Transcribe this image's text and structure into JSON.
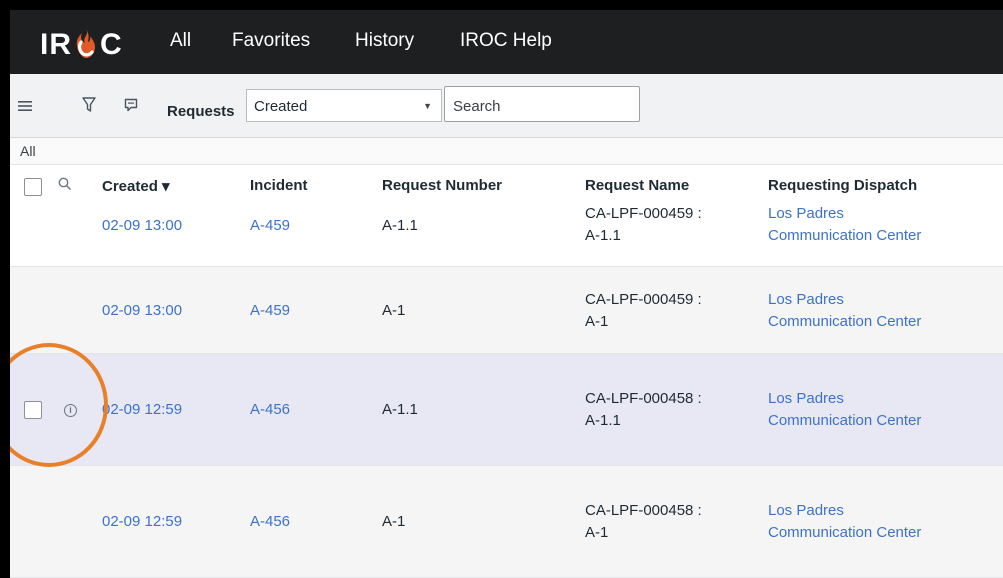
{
  "nav": {
    "logo_text_left": "IR",
    "logo_text_right": "C",
    "links": [
      "All",
      "Favorites",
      "History",
      "IROC Help"
    ]
  },
  "toolbar": {
    "menu_icon": "hamburger-icon",
    "filter_icon": "funnel-icon",
    "chat_icon": "speech-bubble-icon",
    "label": "Requests",
    "select_value": "Created",
    "search_placeholder": "Search"
  },
  "breadcrumb": "All",
  "table": {
    "headers": [
      "Created ▾",
      "Incident",
      "Request Number",
      "Request Name",
      "Requesting Dispatch"
    ],
    "rows": [
      {
        "created": "02-09 13:00",
        "incident": "A-459",
        "request_number": "A-1.1",
        "name1": "CA-LPF-000459 :",
        "name2": "A-1.1",
        "dispatch1": "Los Padres",
        "dispatch2": "Communication Center"
      },
      {
        "created": "02-09 13:00",
        "incident": "A-459",
        "request_number": "A-1",
        "name1": "CA-LPF-000459 :",
        "name2": "A-1",
        "dispatch1": "Los Padres",
        "dispatch2": "Communication Center"
      },
      {
        "created": "02-09 12:59",
        "incident": "A-456",
        "request_number": "A-1.1",
        "name1": "CA-LPF-000458 :",
        "name2": "A-1.1",
        "dispatch1": "Los Padres",
        "dispatch2": "Communication Center"
      },
      {
        "created": "02-09 12:59",
        "incident": "A-456",
        "request_number": "A-1",
        "name1": "CA-LPF-000458 :",
        "name2": "A-1",
        "dispatch1": "Los Padres",
        "dispatch2": "Communication Center"
      }
    ]
  },
  "colors": {
    "link": "#3d72c9",
    "nav_bg": "#1d1f21",
    "highlight_row": "#e8e8f4",
    "annotation": "#e8802a",
    "logo_flame": "#e05a2a"
  }
}
